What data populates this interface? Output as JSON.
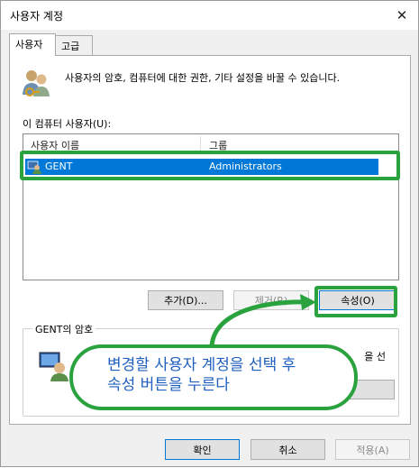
{
  "window": {
    "title": "사용자 계정"
  },
  "tabs": [
    {
      "label": "사용자"
    },
    {
      "label": "고급"
    }
  ],
  "info": {
    "text": "사용자의 암호, 컴퓨터에 대한 권한, 기타 설정을 바꿀 수 있습니다."
  },
  "user_list": {
    "label": "이 컴퓨터 사용자(U):",
    "headers": [
      "사용자 이름",
      "그룹"
    ],
    "rows": [
      {
        "name": "GENT",
        "group": "Administrators",
        "selected": true
      }
    ]
  },
  "buttons": {
    "add": "추가(D)...",
    "remove": "제거(R)",
    "properties": "속성(O)"
  },
  "password_group": {
    "label": "GENT의 암호",
    "text_tail": "을 선",
    "button": ""
  },
  "callout": {
    "text": "변경할 사용자 계정을 선택 후\n속성 버튼을 누른다"
  },
  "footer": {
    "ok": "확인",
    "cancel": "취소",
    "apply": "적용(A)"
  },
  "colors": {
    "highlight": "#2aa33f",
    "selection": "#0078d7",
    "callout_text": "#1f5fbf"
  },
  "icons": {
    "users": "users-icon",
    "user_row": "user-row-icon",
    "password": "password-user-icon",
    "close": "close-icon"
  }
}
